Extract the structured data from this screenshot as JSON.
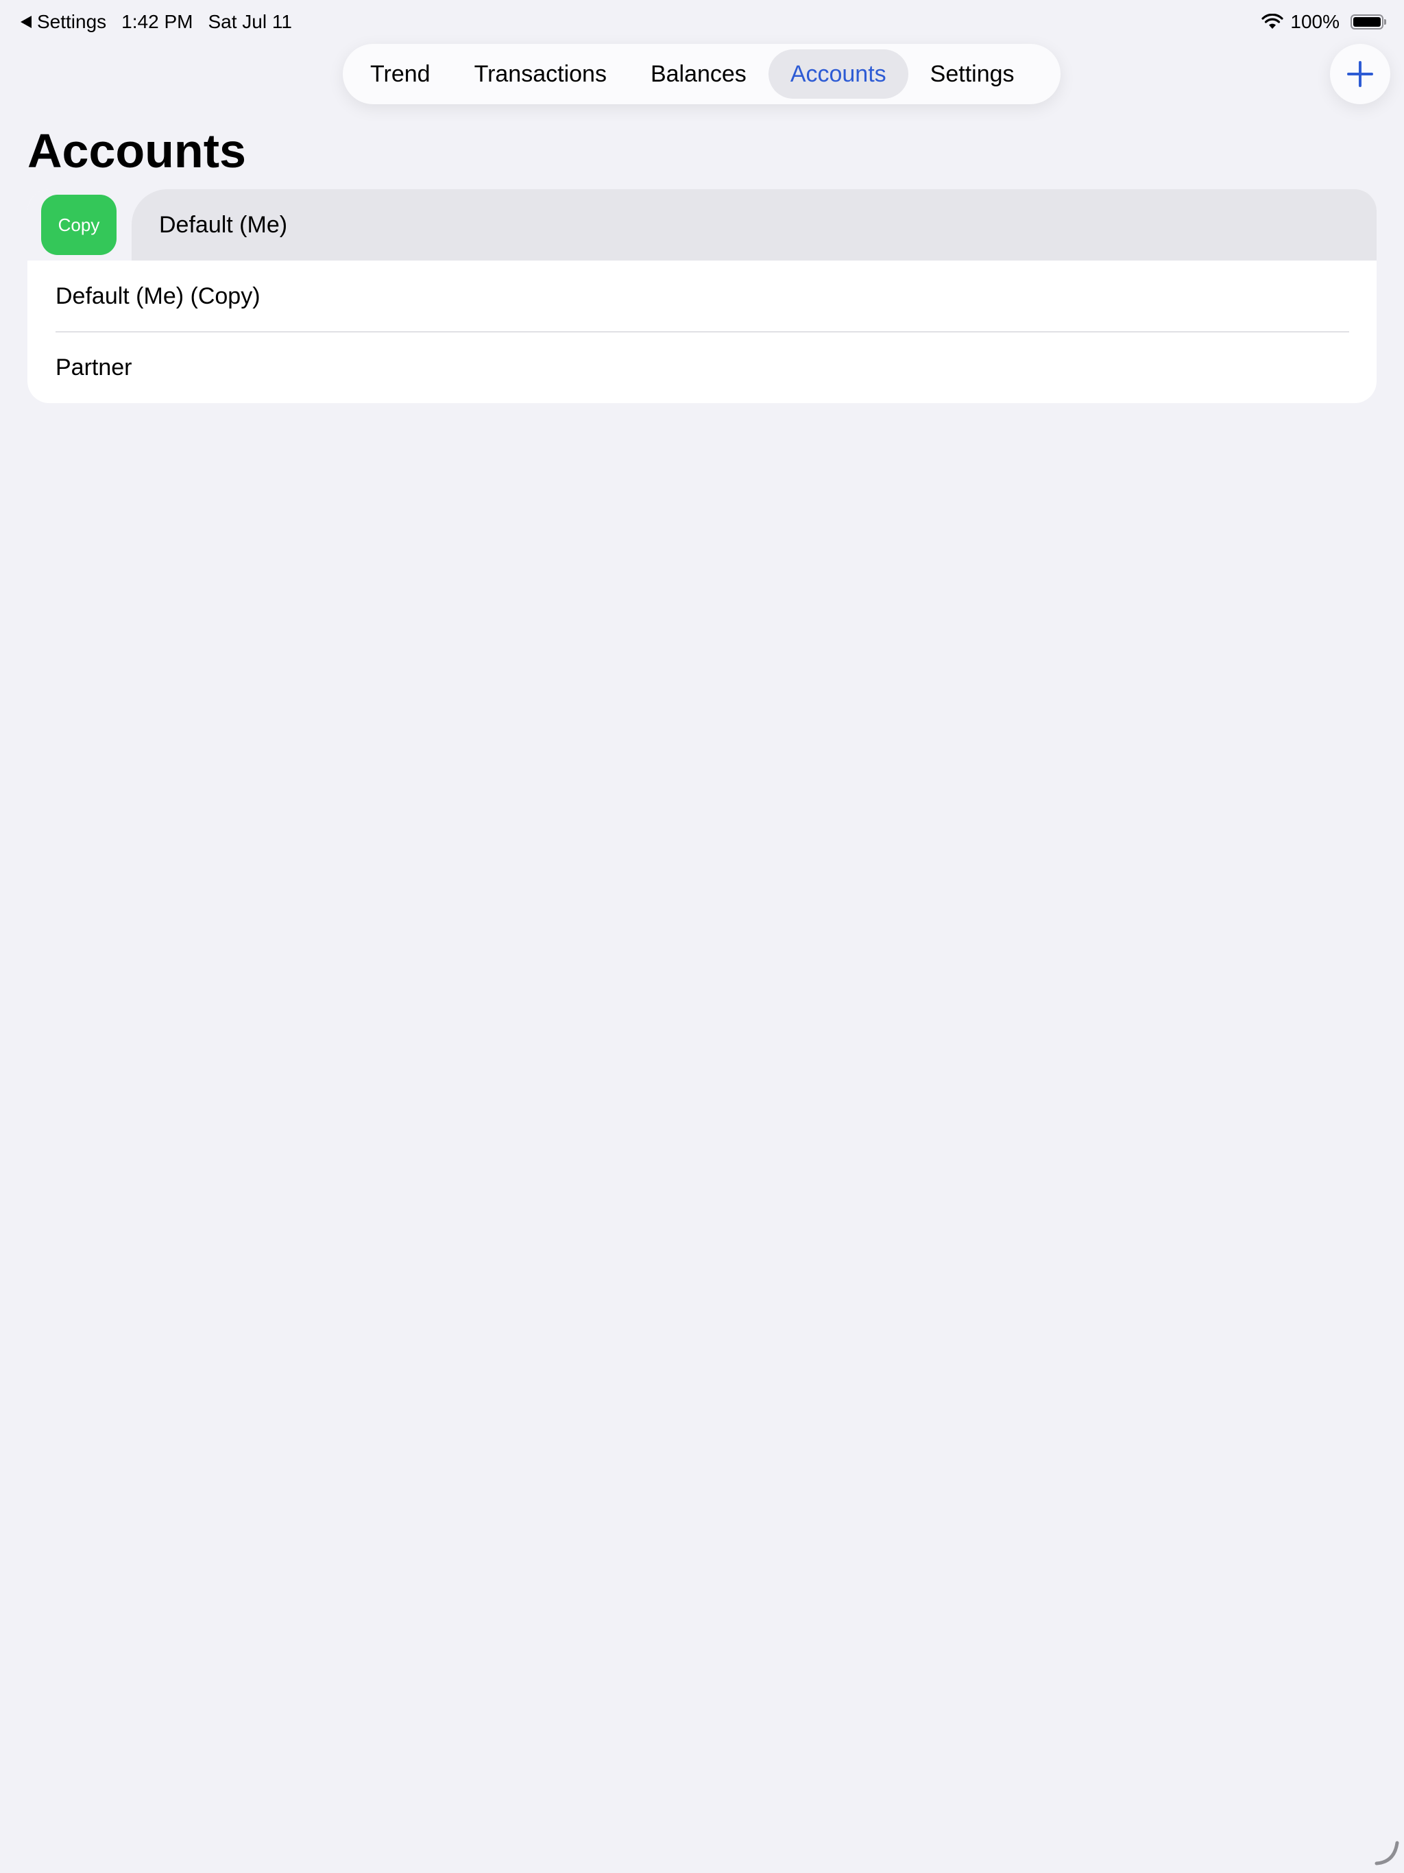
{
  "status_bar": {
    "back_label": "Settings",
    "time": "1:42 PM",
    "date": "Sat Jul 11",
    "battery": "100%",
    "battery_level": 1.0
  },
  "tabs": [
    {
      "label": "Trend",
      "active": false
    },
    {
      "label": "Transactions",
      "active": false
    },
    {
      "label": "Balances",
      "active": false
    },
    {
      "label": "Accounts",
      "active": true
    },
    {
      "label": "Settings",
      "active": false
    }
  ],
  "page": {
    "title": "Accounts"
  },
  "swipe_action": {
    "label": "Copy",
    "color": "#34c759"
  },
  "accounts": [
    {
      "name": "Default (Me)"
    },
    {
      "name": "Default (Me) (Copy)"
    },
    {
      "name": "Partner"
    }
  ],
  "colors": {
    "accent": "#2d5bd4",
    "background": "#f2f2f7",
    "swipe_green": "#34c759"
  },
  "icons": {
    "add": "plus-icon",
    "wifi": "wifi-icon",
    "battery": "battery-icon",
    "back": "back-arrow-icon"
  }
}
